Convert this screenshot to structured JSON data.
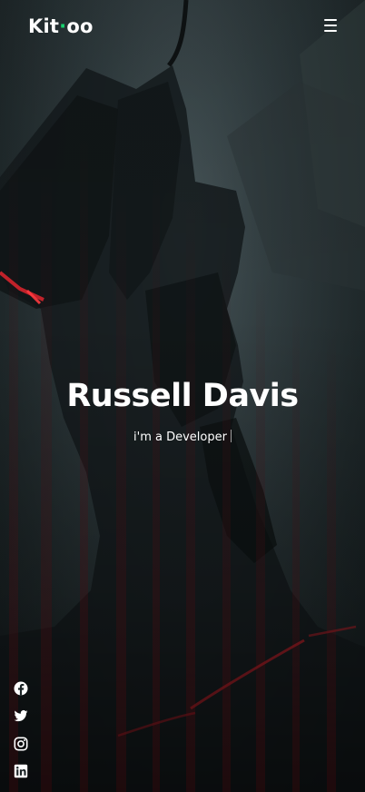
{
  "header": {
    "logo_before": "Kit",
    "logo_dot": "·",
    "logo_after": "oo",
    "menu_icon": "hamburger-icon"
  },
  "hero": {
    "name": "Russell Davis",
    "role_prefix": "i'm a",
    "role_word": "Developer"
  },
  "social": [
    {
      "icon": "facebook-icon"
    },
    {
      "icon": "twitter-icon"
    },
    {
      "icon": "instagram-icon"
    },
    {
      "icon": "linkedin-icon"
    }
  ],
  "colors": {
    "accent": "#18d26e",
    "text": "#ffffff",
    "background": "#2c373a",
    "glow": "#d0202a"
  }
}
